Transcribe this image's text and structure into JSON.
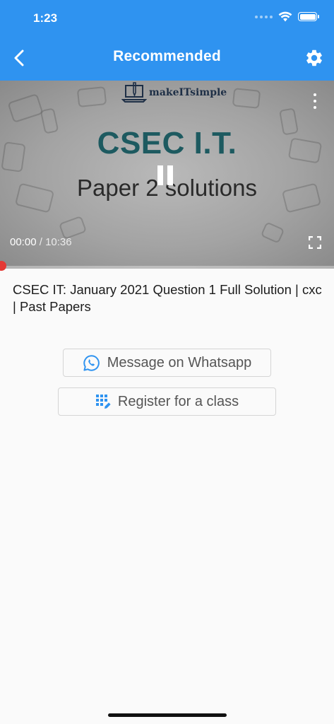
{
  "status_bar": {
    "time": "1:23",
    "icons": [
      "signal-icon",
      "wifi-icon",
      "battery-icon"
    ]
  },
  "header": {
    "title": "Recommended",
    "back_icon": "chevron-left-icon",
    "settings_icon": "gear-icon",
    "background_color": "#2f93f0"
  },
  "video": {
    "brand": "makeITsimple",
    "title": "CSEC I.T.",
    "subtitle": "Paper 2 solutions",
    "current_time": "00:00",
    "separator": "/",
    "duration": "10:36",
    "progress": 0.0,
    "accent_color": "#e53935"
  },
  "video_info": {
    "title": "CSEC IT: January 2021 Question 1 Full Solution | cxc | Past Papers"
  },
  "actions": {
    "whatsapp_label": "Message on Whatsapp",
    "register_label": "Register for a class",
    "icon_color": "#2f93f0"
  }
}
